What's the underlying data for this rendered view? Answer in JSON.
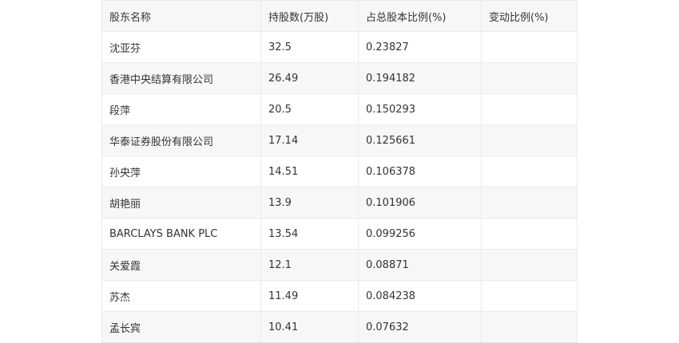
{
  "table": {
    "headers": [
      "股东名称",
      "持股数(万股)",
      "占总股本比例(%)",
      "变动比例(%)"
    ],
    "rows": [
      [
        "沈亚芬",
        "32.5",
        "0.23827",
        ""
      ],
      [
        "香港中央结算有限公司",
        "26.49",
        "0.194182",
        ""
      ],
      [
        "段萍",
        "20.5",
        "0.150293",
        ""
      ],
      [
        "华泰证券股份有限公司",
        "17.14",
        "0.125661",
        ""
      ],
      [
        "孙央萍",
        "14.51",
        "0.106378",
        ""
      ],
      [
        "胡艳丽",
        "13.9",
        "0.101906",
        ""
      ],
      [
        "BARCLAYS BANK PLC",
        "13.54",
        "0.099256",
        ""
      ],
      [
        "关爱霞",
        "12.1",
        "0.08871",
        ""
      ],
      [
        "苏杰",
        "11.49",
        "0.084238",
        ""
      ],
      [
        "孟长宾",
        "10.41",
        "0.07632",
        ""
      ]
    ]
  }
}
